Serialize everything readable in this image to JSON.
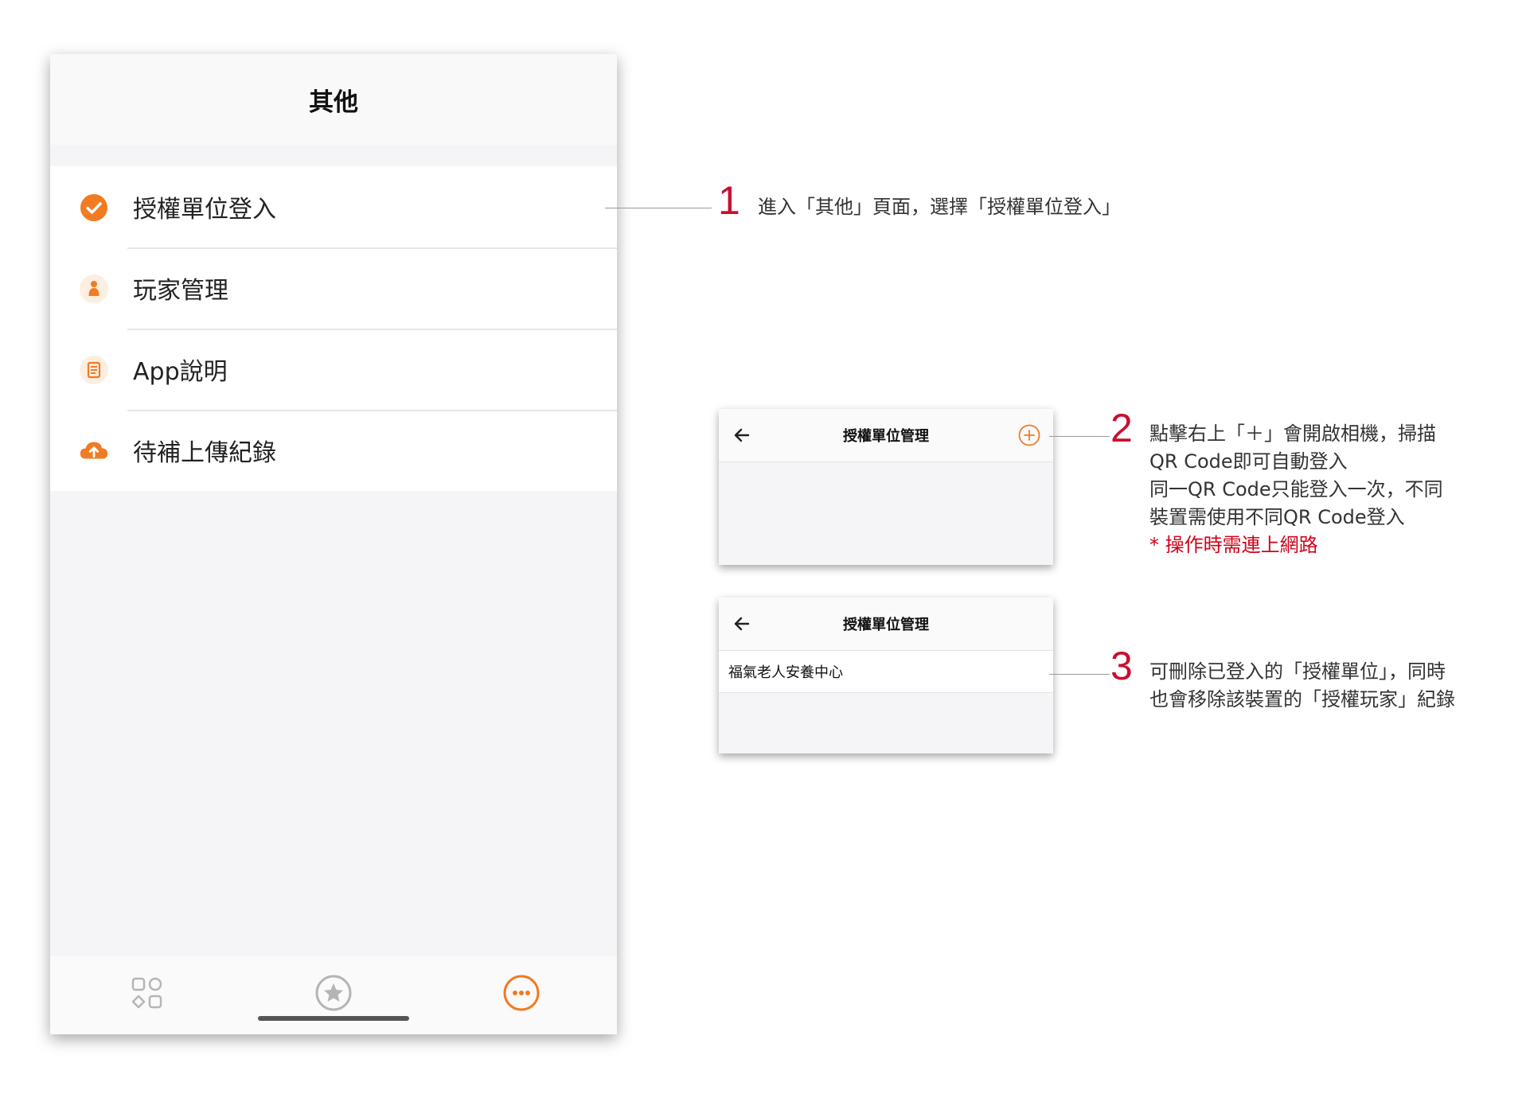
{
  "phone": {
    "title": "其他",
    "menu": [
      {
        "label": "授權單位登入",
        "icon": "check-circle-icon"
      },
      {
        "label": "玩家管理",
        "icon": "person-icon"
      },
      {
        "label": "App說明",
        "icon": "document-icon"
      },
      {
        "label": "待補上傳紀錄",
        "icon": "cloud-upload-icon"
      }
    ],
    "tabs": [
      {
        "icon": "grid-shapes-icon",
        "active": false
      },
      {
        "icon": "star-circle-icon",
        "active": false
      },
      {
        "icon": "more-circle-icon",
        "active": true
      }
    ]
  },
  "steps": [
    {
      "number": "1",
      "lines": [
        "進入「其他」頁面，選擇「授權單位登入」"
      ]
    },
    {
      "number": "2",
      "lines": [
        "點擊右上「＋」會開啟相機，掃描",
        "QR Code即可自動登入",
        "同一QR Code只能登入一次，不同",
        "裝置需使用不同QR Code登入"
      ],
      "warning": "*  操作時需連上網路"
    },
    {
      "number": "3",
      "lines": [
        "可刪除已登入的「授權單位」，同時",
        "也會移除該裝置的「授權玩家」紀錄"
      ]
    }
  ],
  "mini_screens": [
    {
      "title": "授權單位管理",
      "has_plus": true,
      "rows": []
    },
    {
      "title": "授權單位管理",
      "has_plus": false,
      "rows": [
        "福氣老人安養中心"
      ]
    }
  ],
  "colors": {
    "accent": "#f07b22",
    "step_number": "#c8102e",
    "warning": "#d0021b"
  }
}
